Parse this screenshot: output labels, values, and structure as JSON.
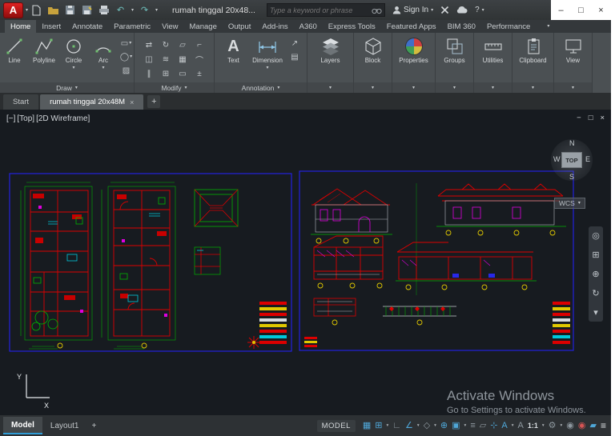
{
  "titlebar": {
    "app_initial": "A",
    "title": "rumah tinggal 20x48...",
    "search_placeholder": "Type a keyword or phrase",
    "sign_in": "Sign In",
    "help": "?",
    "qat": [
      "new-file",
      "open-file",
      "save",
      "save-as",
      "plot",
      "undo",
      "redo"
    ],
    "window_buttons": {
      "minimize": "–",
      "maximize": "□",
      "close": "×"
    }
  },
  "glyphs": {
    "caret": "▾",
    "undo": "↶",
    "redo": "↷",
    "text_icon": "A"
  },
  "ribbon_tabs": [
    "Home",
    "Insert",
    "Annotate",
    "Parametric",
    "View",
    "Manage",
    "Output",
    "Add-ins",
    "A360",
    "Express Tools",
    "Featured Apps",
    "BIM 360",
    "Performance"
  ],
  "ribbon": {
    "draw": {
      "label": "Draw",
      "tools": [
        "Line",
        "Polyline",
        "Circle",
        "Arc"
      ],
      "extra_icons": [
        "▭",
        "◯",
        "▨"
      ]
    },
    "modify": {
      "label": "Modify",
      "icons": [
        "⇄",
        "↻",
        "▱",
        "⌐",
        "◫",
        "≋",
        "▦",
        "⌒",
        "∥",
        "⊞",
        "▭",
        "±"
      ]
    },
    "annotation": {
      "label": "Annotation",
      "tools": [
        "Text",
        "Dimension"
      ],
      "extra_icons": [
        "↗",
        "▤"
      ]
    },
    "compact_panels": [
      "Layers",
      "Block",
      "Properties",
      "Groups",
      "Utilities",
      "Clipboard",
      "View"
    ]
  },
  "file_tabs": {
    "start": "Start",
    "document": "rumah tinggal 20x48M",
    "close": "×",
    "new_tab": "+"
  },
  "viewport": {
    "controls": {
      "minimize": "[−]",
      "view": "[Top]",
      "visual_style": "[2D Wireframe]"
    },
    "viewcube": {
      "n": "N",
      "w": "W",
      "e": "E",
      "s": "S",
      "top": "TOP"
    },
    "wcs": "WCS",
    "nav_icons": [
      "◎",
      "⊞",
      "⊕",
      "↻",
      "▾"
    ],
    "window_buttons": {
      "minimize": "−",
      "restore": "□",
      "close": "×"
    },
    "watermark": {
      "line1": "Activate Windows",
      "line2": "Go to Settings to activate Windows."
    }
  },
  "statusbar": {
    "model_tab": "Model",
    "layout_tab": "Layout1",
    "add_layout": "+",
    "space_label": "MODEL",
    "icons": [
      {
        "name": "grid-display",
        "g": "▦",
        "on": true
      },
      {
        "name": "snap-mode",
        "g": "⊞",
        "on": true
      },
      {
        "name": "ortho-mode",
        "g": "∟",
        "on": false
      },
      {
        "name": "polar-tracking",
        "g": "∠",
        "on": true
      },
      {
        "name": "isometric-drafting",
        "g": "◇",
        "on": false
      },
      {
        "name": "object-snap-tracking",
        "g": "⊕",
        "on": true
      },
      {
        "name": "object-snap",
        "g": "▣",
        "on": true
      },
      {
        "name": "lineweight",
        "g": "≡",
        "on": false
      },
      {
        "name": "transparency",
        "g": "▱",
        "on": false
      },
      {
        "name": "dynamic-input",
        "g": "⊹",
        "on": true
      },
      {
        "name": "annotation-visibility",
        "g": "A",
        "on": true
      },
      {
        "name": "annotation-autoscale",
        "g": "A",
        "on": false
      },
      {
        "name": "annotation-scale",
        "g": "1:1",
        "on": true
      },
      {
        "name": "workspace-switching",
        "g": "⚙",
        "on": false
      },
      {
        "name": "annotation-monitor",
        "g": "◉",
        "on": false
      },
      {
        "name": "isolate-objects",
        "g": "◉",
        "on": false
      },
      {
        "name": "graphics-performance",
        "g": "▰",
        "on": true
      },
      {
        "name": "customization-menu",
        "g": "≡",
        "on": true
      }
    ]
  }
}
